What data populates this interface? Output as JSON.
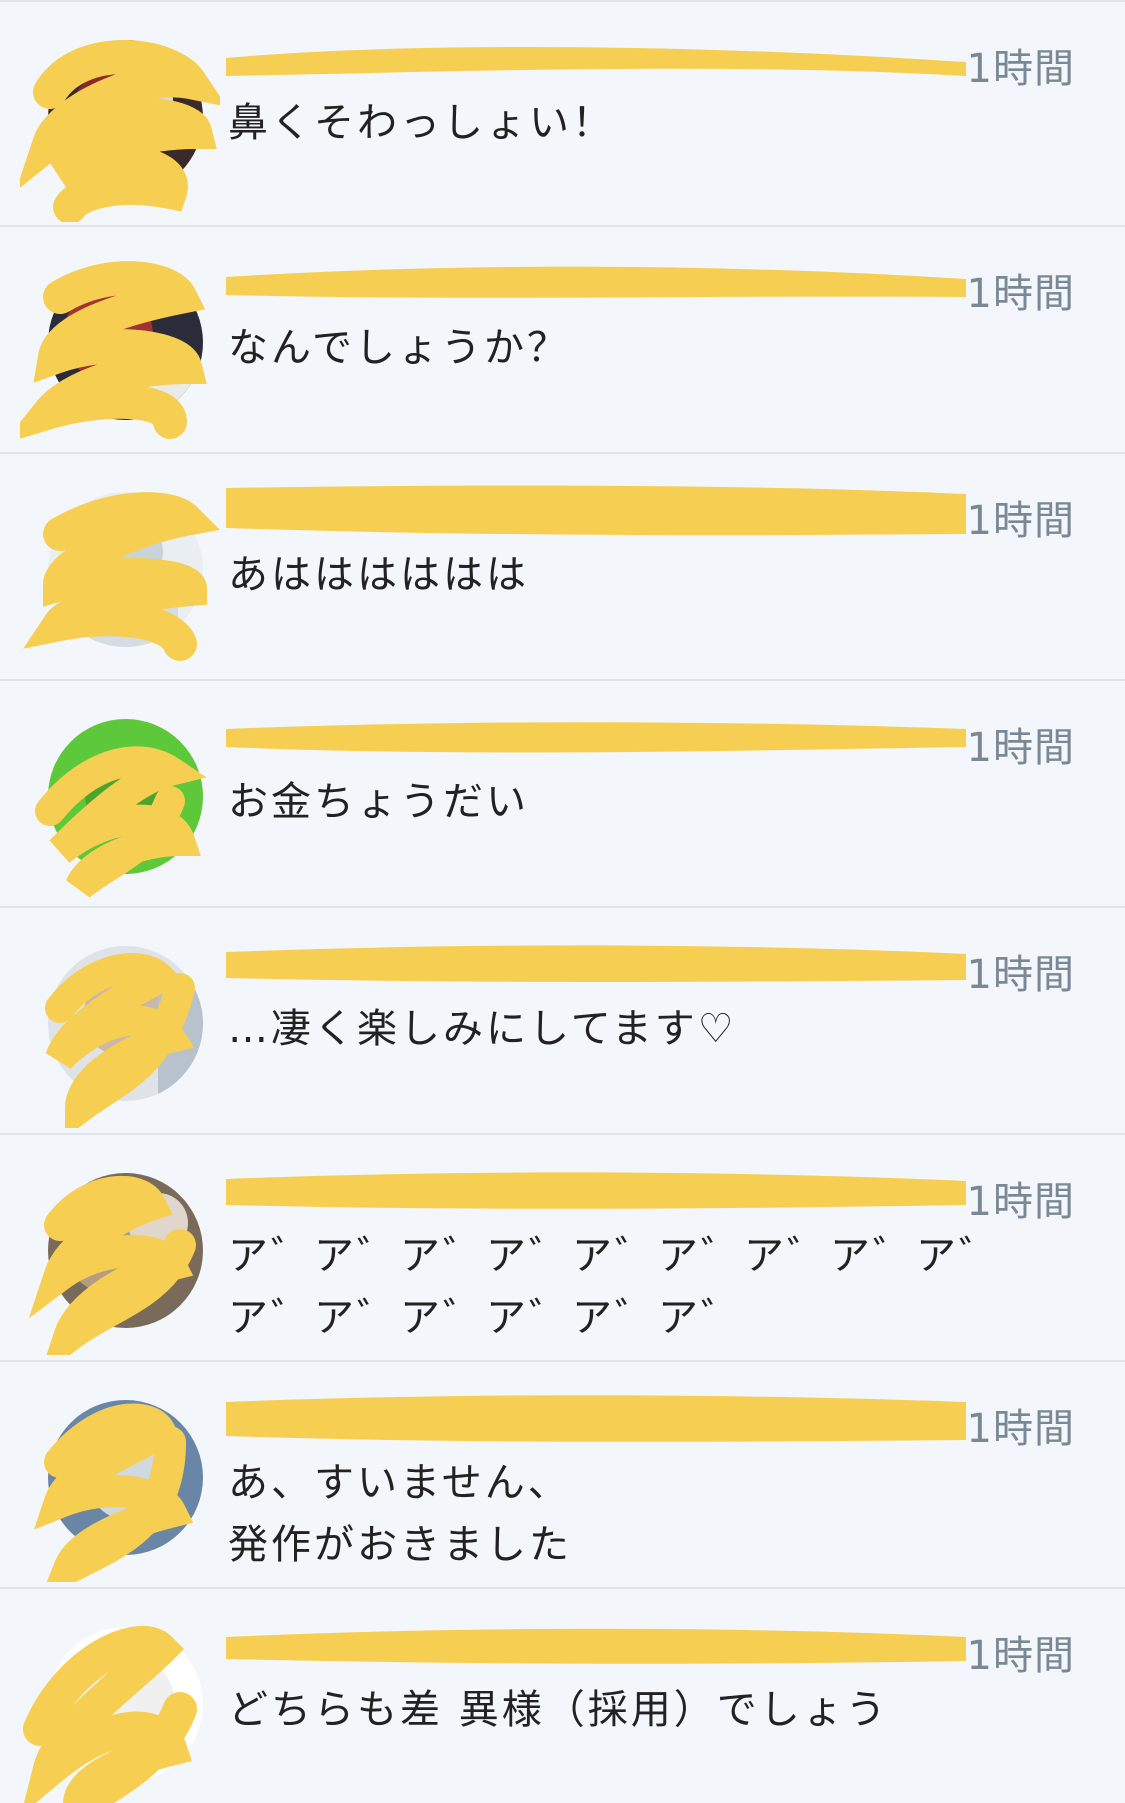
{
  "colors": {
    "background": "#f3f7fb",
    "divider": "#dfe5eb",
    "redaction": "#f6cf52",
    "time_text": "#7a8794",
    "body_text": "#222222"
  },
  "notifications": [
    {
      "time": "1時間",
      "message": "鼻くそわっしょい！",
      "avatar_icon": "user-avatar-redacted"
    },
    {
      "time": "1時間",
      "message": "なんでしょうか？",
      "avatar_icon": "user-avatar-redacted"
    },
    {
      "time": "1時間",
      "message": "あはははははは",
      "avatar_icon": "user-avatar-redacted"
    },
    {
      "time": "1時間",
      "message": "お金ちょうだい",
      "avatar_icon": "user-avatar-redacted"
    },
    {
      "time": "1時間",
      "message": "…凄く楽しみにしてます♡",
      "avatar_icon": "user-avatar-redacted"
    },
    {
      "time": "1時間",
      "message": "ア゛ア゛ア゛ア゛ア゛ア゛ア゛ア゛ア゛ア゛ア゛ア゛ア゛ア゛ア゛",
      "avatar_icon": "user-avatar-redacted"
    },
    {
      "time": "1時間",
      "message": "あ、すいません、\n発作がおきました",
      "avatar_icon": "user-avatar-redacted"
    },
    {
      "time": "1時間",
      "message": "どちらも差 異様（採用）でしょう",
      "avatar_icon": "user-avatar-redacted"
    }
  ]
}
